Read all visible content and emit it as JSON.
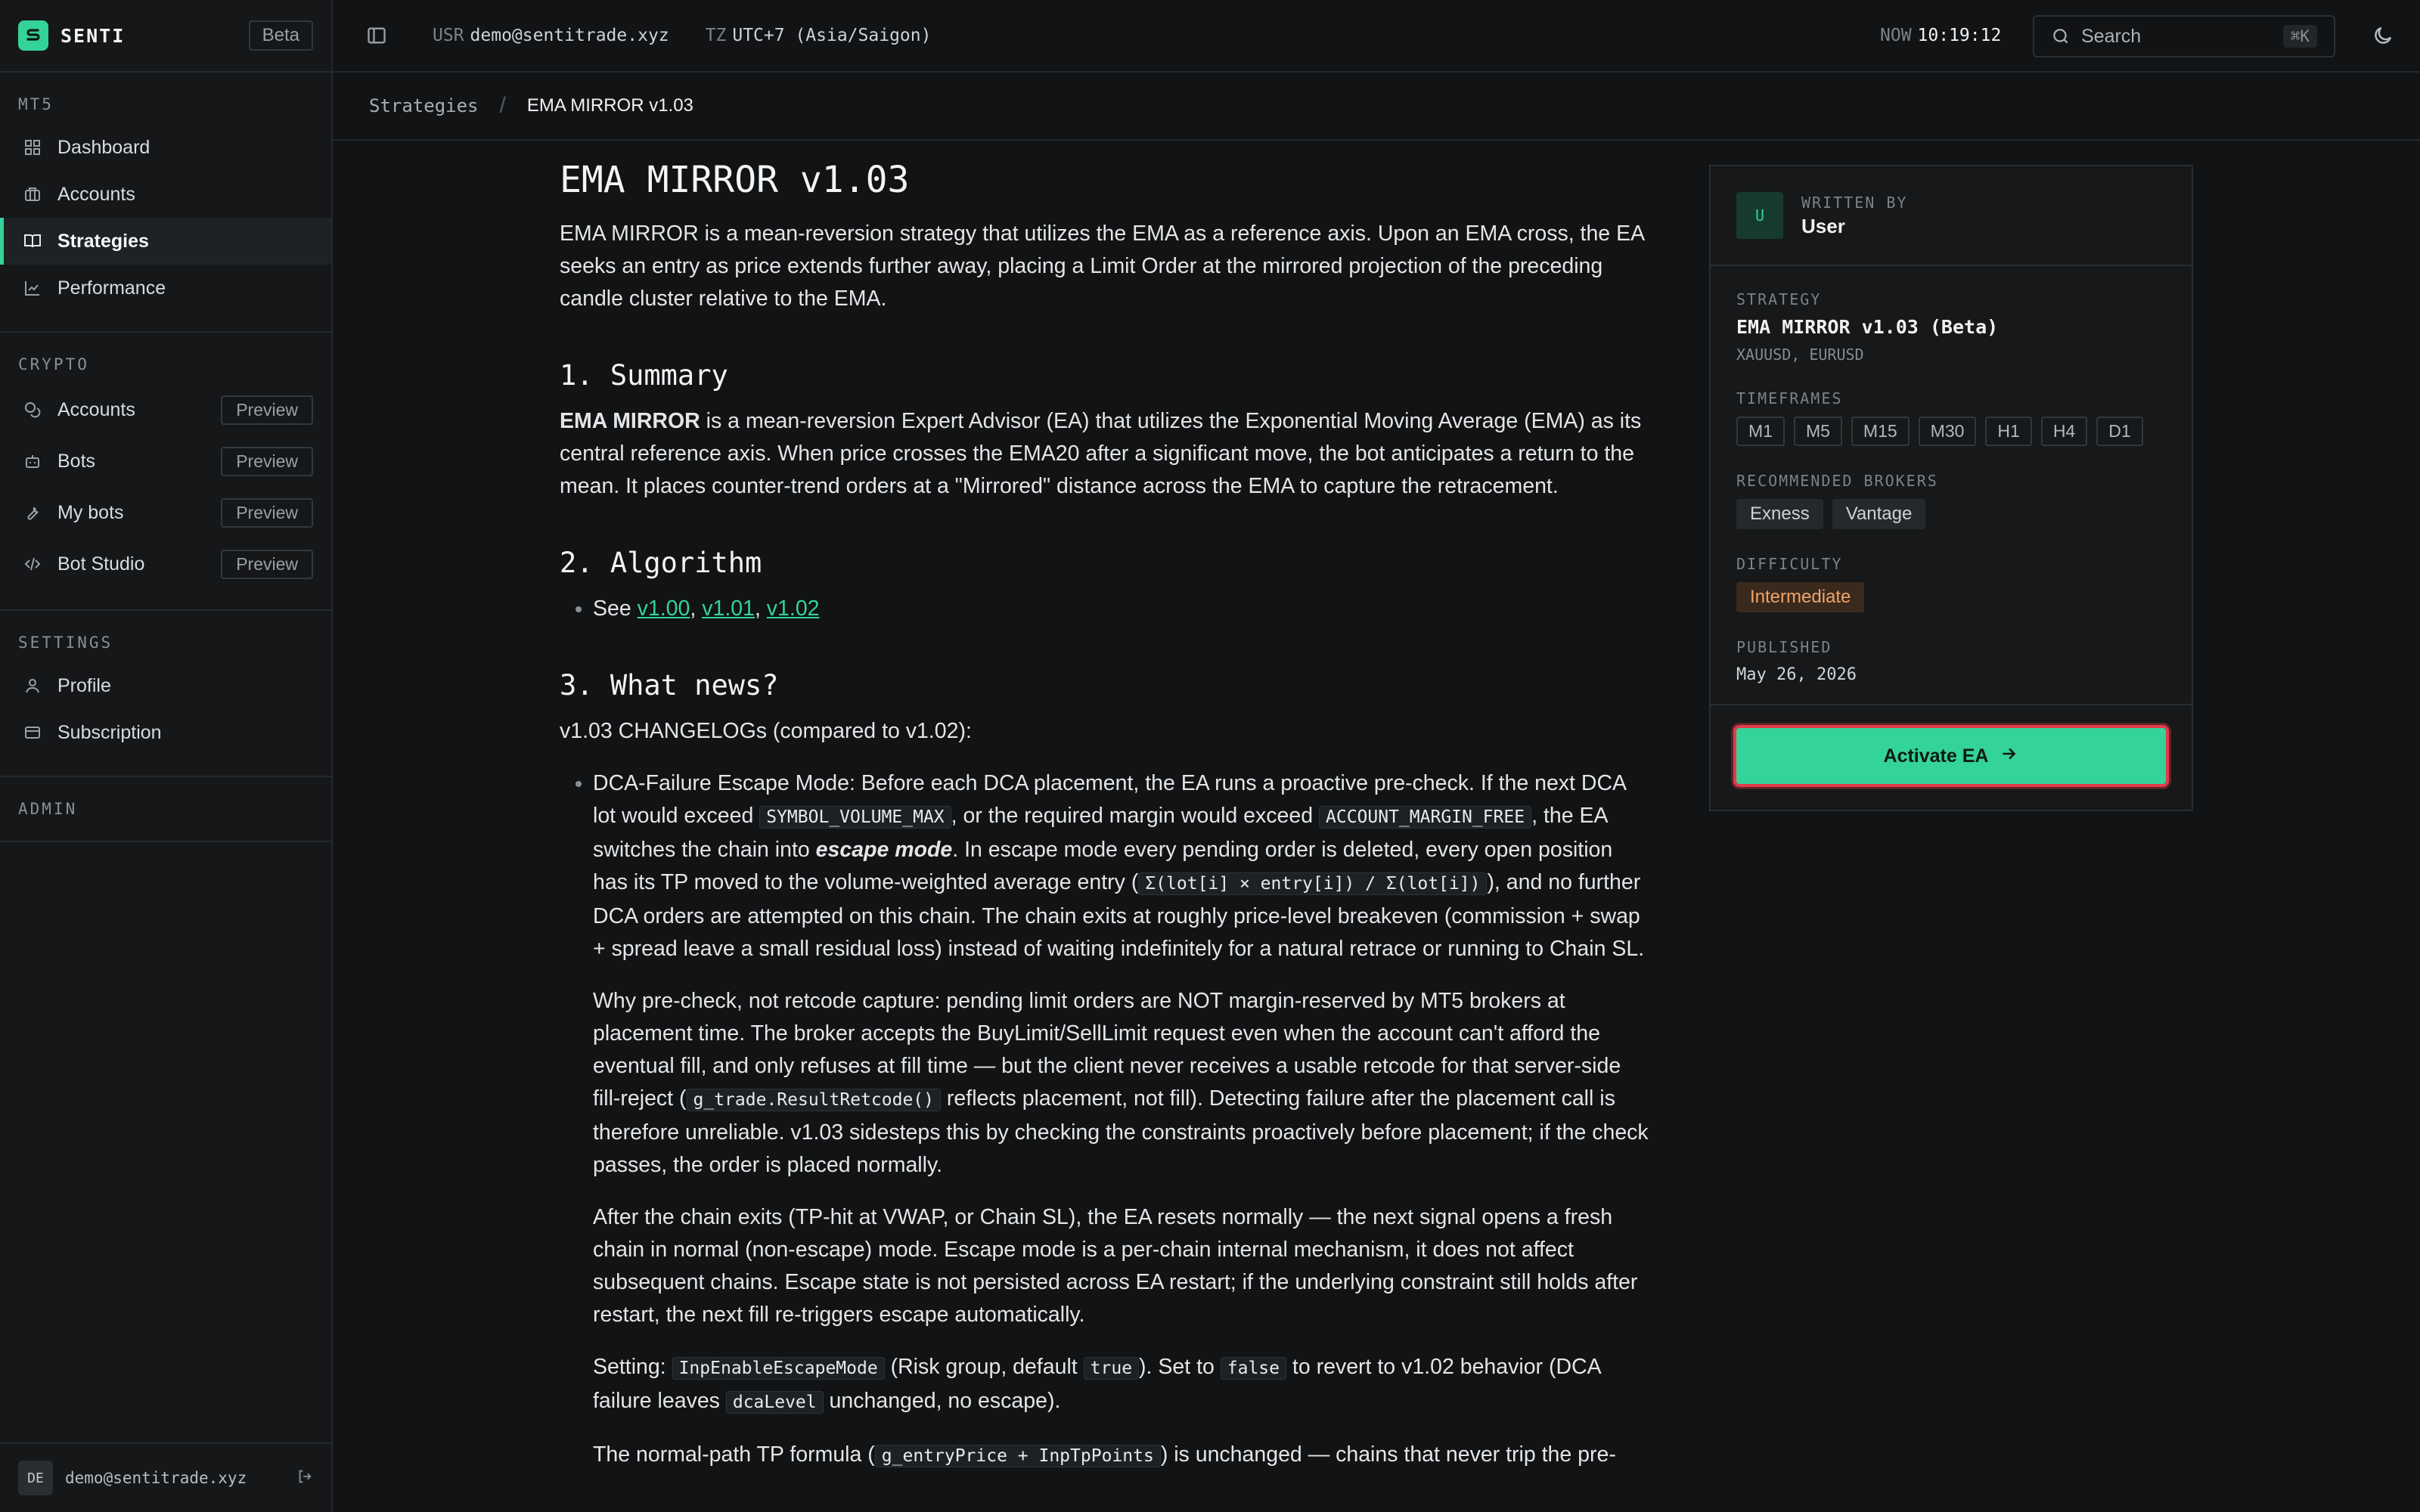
{
  "app": {
    "name": "SENTI",
    "badge": "Beta"
  },
  "sidebar": {
    "sections": [
      {
        "title": "MT5",
        "items": [
          {
            "label": "Dashboard",
            "icon": "grid-icon"
          },
          {
            "label": "Accounts",
            "icon": "briefcase-icon"
          },
          {
            "label": "Strategies",
            "icon": "book-icon",
            "active": true
          },
          {
            "label": "Performance",
            "icon": "chart-line-icon"
          }
        ]
      },
      {
        "title": "CRYPTO",
        "items": [
          {
            "label": "Accounts",
            "icon": "coins-icon",
            "badge": "Preview"
          },
          {
            "label": "Bots",
            "icon": "bot-icon",
            "badge": "Preview"
          },
          {
            "label": "My bots",
            "icon": "wrench-icon",
            "badge": "Preview"
          },
          {
            "label": "Bot Studio",
            "icon": "code-icon",
            "badge": "Preview"
          }
        ]
      },
      {
        "title": "SETTINGS",
        "items": [
          {
            "label": "Profile",
            "icon": "user-icon"
          },
          {
            "label": "Subscription",
            "icon": "card-icon"
          }
        ]
      },
      {
        "title": "ADMIN",
        "items": []
      }
    ],
    "user": {
      "initials": "DE",
      "email": "demo@sentitrade.xyz"
    }
  },
  "topbar": {
    "usr_label": "USR",
    "usr_value": "demo@sentitrade.xyz",
    "tz_label": "TZ",
    "tz_value": "UTC+7 (Asia/Saigon)",
    "now_label": "NOW",
    "now_value": "10:19:12",
    "search_placeholder": "Search",
    "search_shortcut": "⌘K"
  },
  "breadcrumb": {
    "parent": "Strategies",
    "current": "EMA MIRROR v1.03"
  },
  "article": {
    "title": "EMA MIRROR v1.03",
    "intro": "EMA MIRROR is a mean-reversion strategy that utilizes the EMA as a reference axis. Upon an EMA cross, the EA seeks an entry as price extends further away, placing a Limit Order at the mirrored projection of the preceding candle cluster relative to the EMA.",
    "h_summary": "1. Summary",
    "summary_bold": "EMA MIRROR",
    "summary_rest": " is a mean-reversion Expert Advisor (EA) that utilizes the Exponential Moving Average (EMA) as its central reference axis. When price crosses the EMA20 after a significant move, the bot anticipates a return to the mean. It places counter-trend orders at a \"Mirrored\" distance across the EMA to capture the retracement.",
    "h_algorithm": "2. Algorithm",
    "algo_see": "See ",
    "algo_links": [
      "v1.00",
      "v1.01",
      "v1.02"
    ],
    "h_news": "3. What news?",
    "changelog_intro": "v1.03 CHANGELOGs (compared to v1.02):",
    "b1_a": "DCA-Failure Escape Mode: Before each DCA placement, the EA runs a proactive pre-check. If the next DCA lot would exceed ",
    "b1_code1": "SYMBOL_VOLUME_MAX",
    "b1_b": ", or the required margin would exceed ",
    "b1_code2": "ACCOUNT_MARGIN_FREE",
    "b1_c": ", the EA switches the chain into ",
    "b1_em": "escape mode",
    "b1_d": ". In escape mode every pending order is deleted, every open position has its TP moved to the volume-weighted average entry (",
    "b1_code3": "Σ(lot[i] × entry[i]) / Σ(lot[i])",
    "b1_e": "), and no further DCA orders are attempted on this chain. The chain exits at roughly price-level breakeven (commission + swap + spread leave a small residual loss) instead of waiting indefinitely for a natural retrace or running to Chain SL.",
    "p2_a": "Why pre-check, not retcode capture: pending limit orders are NOT margin-reserved by MT5 brokers at placement time. The broker accepts the BuyLimit/SellLimit request even when the account can't afford the eventual fill, and only refuses at fill time — but the client never receives a usable retcode for that server-side fill-reject (",
    "p2_code": "g_trade.ResultRetcode()",
    "p2_b": " reflects placement, not fill). Detecting failure after the placement call is therefore unreliable. v1.03 sidesteps this by checking the constraints proactively before placement; if the check passes, the order is placed normally.",
    "p3": "After the chain exits (TP-hit at VWAP, or Chain SL), the EA resets normally — the next signal opens a fresh chain in normal (non-escape) mode. Escape mode is a per-chain internal mechanism, it does not affect subsequent chains. Escape state is not persisted across EA restart; if the underlying constraint still holds after restart, the next fill re-triggers escape automatically.",
    "p4_a": "Setting: ",
    "p4_code1": "InpEnableEscapeMode",
    "p4_b": " (Risk group, default ",
    "p4_code2": "true",
    "p4_c": "). Set to ",
    "p4_code3": "false",
    "p4_d": " to revert to v1.02 behavior (DCA failure leaves ",
    "p4_code4": "dcaLevel",
    "p4_e": " unchanged, no escape).",
    "p5_a": "The normal-path TP formula (",
    "p5_code": "g_entryPrice + InpTpPoints",
    "p5_b": ") is unchanged — chains that never trip the pre-"
  },
  "card": {
    "author_label": "WRITTEN BY",
    "author_initial": "U",
    "author_name": "User",
    "strategy_label": "STRATEGY",
    "strategy_name": "EMA MIRROR v1.03 (Beta)",
    "symbols": "XAUUSD, EURUSD",
    "timeframes_label": "TIMEFRAMES",
    "timeframes": [
      "M1",
      "M5",
      "M15",
      "M30",
      "H1",
      "H4",
      "D1"
    ],
    "brokers_label": "RECOMMENDED BROKERS",
    "brokers": [
      "Exness",
      "Vantage"
    ],
    "difficulty_label": "DIFFICULTY",
    "difficulty": "Intermediate",
    "published_label": "PUBLISHED",
    "published": "May 26, 2026",
    "activate_label": "Activate EA"
  },
  "colors": {
    "accent": "#34d399",
    "highlight": "#e23b48",
    "difficulty": "#f0a46a"
  }
}
